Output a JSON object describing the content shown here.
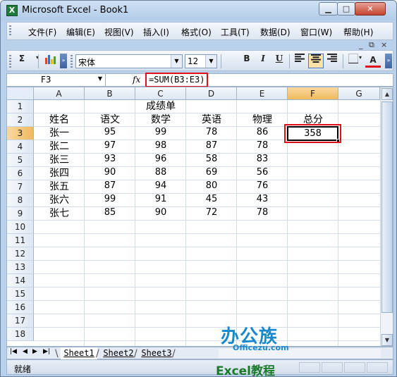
{
  "window": {
    "title": "Microsoft Excel - Book1",
    "app_icon": "excel-icon",
    "controls": {
      "minimize": "▁",
      "maximize": "□",
      "close": "✕"
    }
  },
  "menu": {
    "items": [
      "文件(F)",
      "编辑(E)",
      "视图(V)",
      "插入(I)",
      "格式(O)",
      "工具(T)",
      "数据(D)",
      "窗口(W)",
      "帮助(H)"
    ],
    "mdi_controls": [
      "_",
      "⧉",
      "×"
    ]
  },
  "toolbar": {
    "sum": "Σ",
    "chart_icon": "chart-icon",
    "font_name": "宋体",
    "font_size": "12",
    "bold": "B",
    "italic": "I",
    "underline": "U",
    "align_left_icon": "align-left-icon",
    "align_center_icon": "align-center-icon",
    "align_right_icon": "align-right-icon",
    "borders_icon": "borders-icon",
    "font_color": "A",
    "font_color_accent": "#e0101a"
  },
  "formula_bar": {
    "name_box": "F3",
    "fx": "fx",
    "formula": "=SUM(B3:E3)"
  },
  "sheet": {
    "columns": [
      "A",
      "B",
      "C",
      "D",
      "E",
      "F",
      "G"
    ],
    "selected_column": "F",
    "selected_row": "3",
    "rows": [
      "1",
      "2",
      "3",
      "4",
      "5",
      "6",
      "7",
      "8",
      "9",
      "10",
      "11",
      "12",
      "13",
      "14",
      "15",
      "16",
      "17",
      "18"
    ],
    "title": "成绩单",
    "headers": [
      "姓名",
      "语文",
      "数学",
      "英语",
      "物理",
      "总分"
    ],
    "students": [
      {
        "name": "张一",
        "chinese": "95",
        "math": "99",
        "english": "78",
        "physics": "86"
      },
      {
        "name": "张二",
        "chinese": "97",
        "math": "98",
        "english": "87",
        "physics": "78"
      },
      {
        "name": "张三",
        "chinese": "93",
        "math": "96",
        "english": "58",
        "physics": "83"
      },
      {
        "name": "张四",
        "chinese": "90",
        "math": "88",
        "english": "69",
        "physics": "56"
      },
      {
        "name": "张五",
        "chinese": "87",
        "math": "94",
        "english": "80",
        "physics": "76"
      },
      {
        "name": "张六",
        "chinese": "99",
        "math": "91",
        "english": "45",
        "physics": "43"
      },
      {
        "name": "张七",
        "chinese": "85",
        "math": "90",
        "english": "72",
        "physics": "78"
      }
    ],
    "active_cell_value": "358",
    "highlight_color": "#e0101a"
  },
  "tabs": {
    "nav": [
      "|◀",
      "◀",
      "▶",
      "▶|"
    ],
    "sheets": [
      "Sheet1",
      "Sheet2",
      "Sheet3"
    ],
    "active": "Sheet1"
  },
  "watermark": {
    "logo": "办公族",
    "site": "Officezu.com",
    "caption": "Excel教程"
  },
  "status": {
    "text": "就绪"
  }
}
